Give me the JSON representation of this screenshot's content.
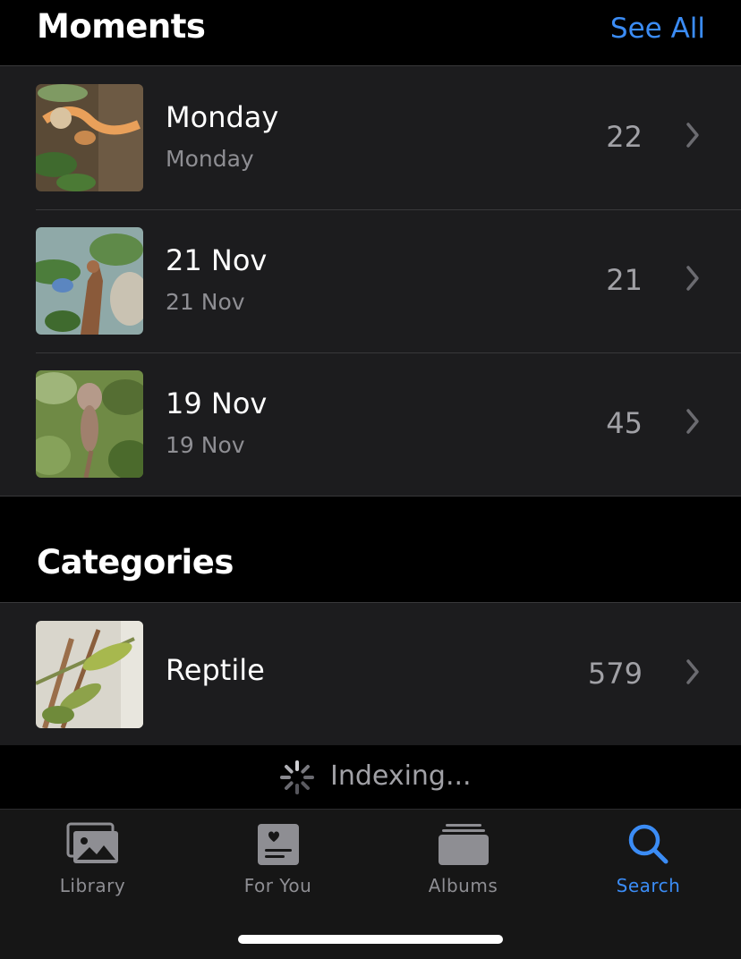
{
  "moments": {
    "title": "Moments",
    "see_all": "See All",
    "items": [
      {
        "title": "Monday",
        "subtitle": "Monday",
        "count": "22"
      },
      {
        "title": "21 Nov",
        "subtitle": "21 Nov",
        "count": "21"
      },
      {
        "title": "19 Nov",
        "subtitle": "19 Nov",
        "count": "45"
      }
    ]
  },
  "categories": {
    "title": "Categories",
    "items": [
      {
        "title": "Reptile",
        "count": "579"
      }
    ]
  },
  "indexing": {
    "label": "Indexing..."
  },
  "tabbar": {
    "tabs": [
      {
        "label": "Library",
        "icon": "photo-library-icon"
      },
      {
        "label": "For You",
        "icon": "for-you-icon"
      },
      {
        "label": "Albums",
        "icon": "albums-icon"
      },
      {
        "label": "Search",
        "icon": "search-icon",
        "active": true
      }
    ]
  },
  "colors": {
    "accent": "#3b8cf5",
    "background": "#000000",
    "list_background": "#1c1c1e",
    "secondary_text": "#8e8e93"
  }
}
